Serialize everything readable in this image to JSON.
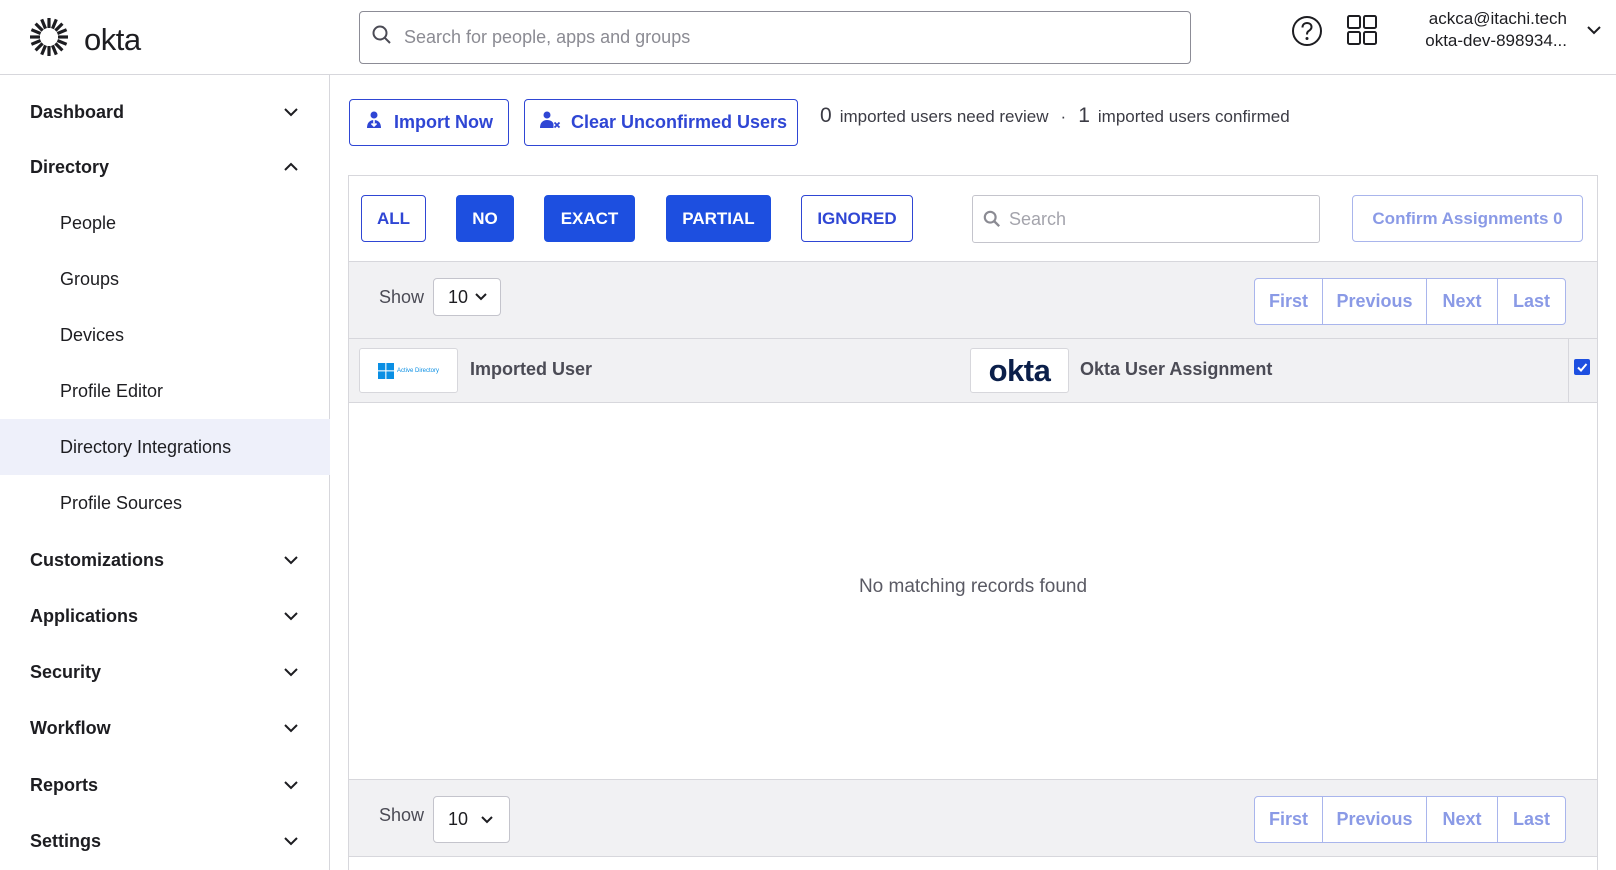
{
  "header": {
    "logo_text": "okta",
    "search_placeholder": "Search for people, apps and groups",
    "user_email": "ackca@itachi.tech",
    "org_name": "okta-dev-898934...",
    "icons": [
      "okta-logo-icon",
      "search-icon",
      "help-icon",
      "apps-grid-icon",
      "chevron-down-icon"
    ]
  },
  "sidebar": {
    "items": [
      {
        "label": "Dashboard",
        "expanded": false
      },
      {
        "label": "Directory",
        "expanded": true
      },
      {
        "label": "Customizations",
        "expanded": false
      },
      {
        "label": "Applications",
        "expanded": false
      },
      {
        "label": "Security",
        "expanded": false
      },
      {
        "label": "Workflow",
        "expanded": false
      },
      {
        "label": "Reports",
        "expanded": false
      },
      {
        "label": "Settings",
        "expanded": false
      }
    ],
    "directory_subitems": [
      {
        "label": "People"
      },
      {
        "label": "Groups"
      },
      {
        "label": "Devices"
      },
      {
        "label": "Profile Editor"
      },
      {
        "label": "Directory Integrations",
        "active": true
      },
      {
        "label": "Profile Sources"
      }
    ]
  },
  "actions": {
    "import_now": "Import Now",
    "clear_unconfirmed": "Clear Unconfirmed Users"
  },
  "summary": {
    "review_count": "0",
    "review_text": "imported users need review",
    "separator": "·",
    "confirmed_count": "1",
    "confirmed_text": "imported users confirmed"
  },
  "filters": {
    "all": "ALL",
    "no": "NO",
    "exact": "EXACT",
    "partial": "PARTIAL",
    "ignored": "IGNORED",
    "selected": [
      "NO",
      "EXACT",
      "PARTIAL"
    ]
  },
  "table": {
    "search_placeholder": "Search",
    "confirm_button": "Confirm Assignments 0",
    "show_label": "Show",
    "page_size": "10",
    "pager": {
      "first": "First",
      "previous": "Previous",
      "next": "Next",
      "last": "Last"
    },
    "col_imported_user": "Imported User",
    "col_okta_assignment": "Okta User Assignment",
    "ad_logo_text": "Active Directory",
    "okta_logo_text": "okta",
    "select_all_checked": true,
    "empty_message": "No matching records found"
  },
  "colors": {
    "accent": "#1d4fe0",
    "accent_outline": "#2f46d4",
    "disabled_accent": "#8a9ae6",
    "active_nav_bg": "#eef0fa",
    "bar_bg": "#f1f1f3"
  }
}
